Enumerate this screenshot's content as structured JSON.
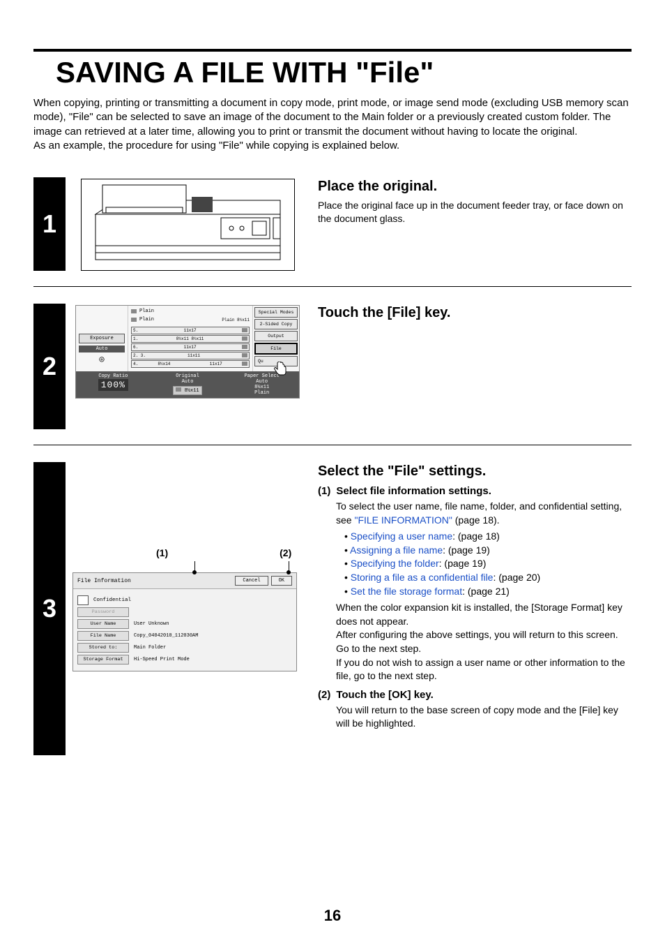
{
  "title": "SAVING A FILE WITH \"File\"",
  "intro": "When copying, printing or transmitting a document in copy mode, print mode, or image send mode (excluding USB memory scan mode), \"File\" can be selected to save an image of the document to the Main folder or a previously created custom folder. The image can retrieved at a later time, allowing you to print or transmit the document without having to locate the original.\nAs an example, the procedure for using \"File\" while copying is explained below.",
  "steps": {
    "s1": {
      "num": "1",
      "heading": "Place the original.",
      "text": "Place the original face up in the document feeder tray, or face down on the document glass."
    },
    "s2": {
      "num": "2",
      "heading": "Touch the [File] key.",
      "panel": {
        "plain1": "Plain",
        "plain2": "Plain",
        "size_top": "Plain 8½x11",
        "btn_special": "Special Modes",
        "btn_2sided": "2-Sided Copy",
        "btn_output": "Output",
        "btn_file": "File",
        "btn_quick": "Qu",
        "exposure_lbl": "Exposure",
        "exposure_val": "Auto",
        "trays": [
          "11x17",
          "8½x11 8½x11",
          "11x17",
          "11x11",
          "8½x14",
          "11x17"
        ],
        "copyratio_lbl": "Copy Ratio",
        "copyratio_val": "100%",
        "original_lbl": "Original",
        "original_val": "Auto",
        "original_size": "8½x11",
        "paper_lbl": "Paper Select",
        "paper_val": "Auto",
        "paper_size": "8½x11",
        "paper_type": "Plain"
      }
    },
    "s3": {
      "num": "3",
      "heading": "Select the \"File\" settings.",
      "callout1": "(1)",
      "callout2": "(2)",
      "panel": {
        "title": "File Information",
        "cancel": "Cancel",
        "ok": "OK",
        "confidential": "Confidential",
        "password": "Password",
        "rows": {
          "username_lbl": "User Name",
          "username_val": "User Unknown",
          "filename_lbl": "File Name",
          "filename_val": "Copy_04042010_112030AM",
          "stored_lbl": "Stored to:",
          "stored_val": "Main Folder",
          "format_lbl": "Storage Format",
          "format_val": "Hi-Speed Print Mode"
        }
      },
      "sub1": {
        "num": "(1)",
        "title": "Select file information settings.",
        "lead": "To select the user name, file name, folder, and confidential setting, see ",
        "lead_link": "\"FILE INFORMATION\"",
        "lead_tail": " (page 18).",
        "bullets": [
          {
            "link": "Specifying a user name",
            "tail": ": (page 18)"
          },
          {
            "link": "Assigning a file name",
            "tail": ": (page 19)"
          },
          {
            "link": "Specifying the folder",
            "tail": ": (page 19)"
          },
          {
            "link": "Storing a file as a confidential file",
            "tail": ": (page 20)"
          },
          {
            "link": "Set the file storage format",
            "tail": ": (page 21)"
          }
        ],
        "post": "When the color expansion kit is installed, the [Storage Format] key does not appear.\nAfter configuring the above settings, you will return to this screen. Go to the next step.\nIf you do not wish to assign a user name or other information to the file, go to the next step."
      },
      "sub2": {
        "num": "(2)",
        "title": "Touch the [OK] key.",
        "text": "You will return to the base screen of copy mode and the [File] key will be highlighted."
      }
    }
  },
  "pagenum": "16"
}
